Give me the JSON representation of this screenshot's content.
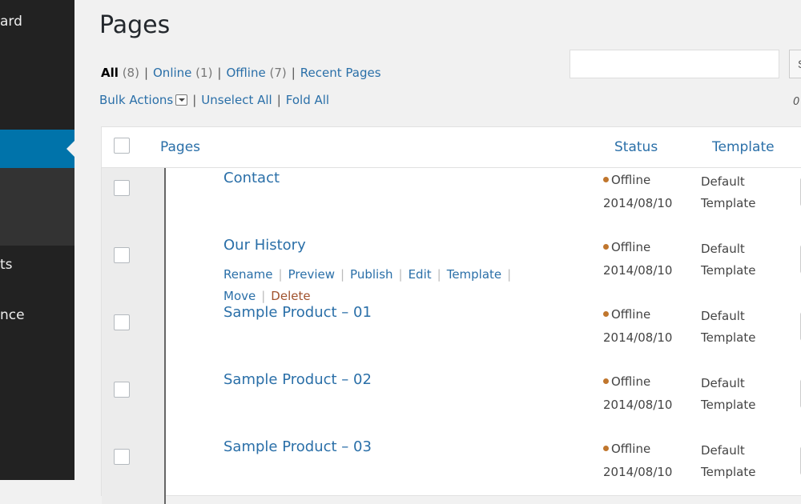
{
  "sidebar": {
    "items": [
      {
        "label": "ard"
      },
      {
        "label": "ts"
      },
      {
        "label": "nce"
      }
    ]
  },
  "page": {
    "title": "Pages"
  },
  "filters": [
    {
      "label": "All",
      "count": "(8)"
    },
    {
      "label": "Online",
      "count": "(1)"
    },
    {
      "label": "Offline",
      "count": "(7)"
    },
    {
      "label": "Recent Pages",
      "count": ""
    }
  ],
  "actions": {
    "bulk": "Bulk Actions",
    "unselect": "Unselect All",
    "fold": "Fold All"
  },
  "search": {
    "value": "",
    "button_label": "S"
  },
  "count_fragment": "0",
  "table": {
    "columns": {
      "pages": "Pages",
      "status": "Status",
      "template": "Template"
    },
    "rows": [
      {
        "title": "Contact",
        "status": "Offline",
        "date": "2014/08/10",
        "template1": "Default",
        "template2": "Template"
      },
      {
        "title": "Our History",
        "status": "Offline",
        "date": "2014/08/10",
        "template1": "Default",
        "template2": "Template"
      },
      {
        "title": "Sample Product – 01",
        "status": "Offline",
        "date": "2014/08/10",
        "template1": "Default",
        "template2": "Template"
      },
      {
        "title": "Sample Product – 02",
        "status": "Offline",
        "date": "2014/08/10",
        "template1": "Default",
        "template2": "Template"
      },
      {
        "title": "Sample Product – 03",
        "status": "Offline",
        "date": "2014/08/10",
        "template1": "Default",
        "template2": "Template"
      }
    ],
    "row_actions": {
      "rename": "Rename",
      "preview": "Preview",
      "publish": "Publish",
      "edit": "Edit",
      "template": "Template",
      "move": "Move",
      "delete": "Delete"
    }
  },
  "colors": {
    "accent": "#0073aa",
    "link": "#2a6fa8",
    "sidebar_bg": "#222222",
    "status_dot": "#c0762d",
    "delete": "#a0522d"
  }
}
